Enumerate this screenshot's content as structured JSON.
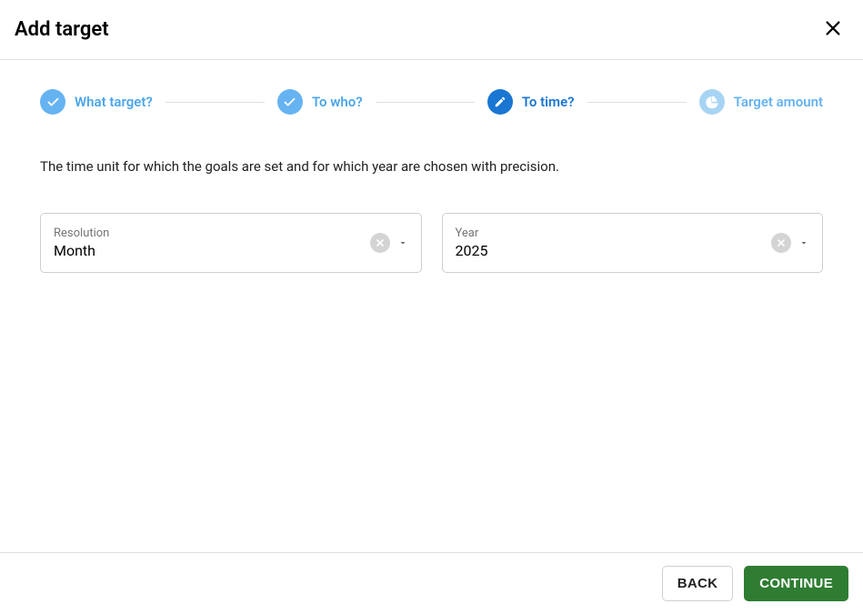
{
  "header": {
    "title": "Add target"
  },
  "stepper": {
    "steps": [
      {
        "label": "What target?"
      },
      {
        "label": "To who?"
      },
      {
        "label": "To time?"
      },
      {
        "label": "Target amount"
      }
    ]
  },
  "description": "The time unit for which the goals are set and for which year are chosen with precision.",
  "form": {
    "resolution": {
      "label": "Resolution",
      "value": "Month"
    },
    "year": {
      "label": "Year",
      "value": "2025"
    }
  },
  "footer": {
    "back_label": "BACK",
    "continue_label": "CONTINUE"
  }
}
